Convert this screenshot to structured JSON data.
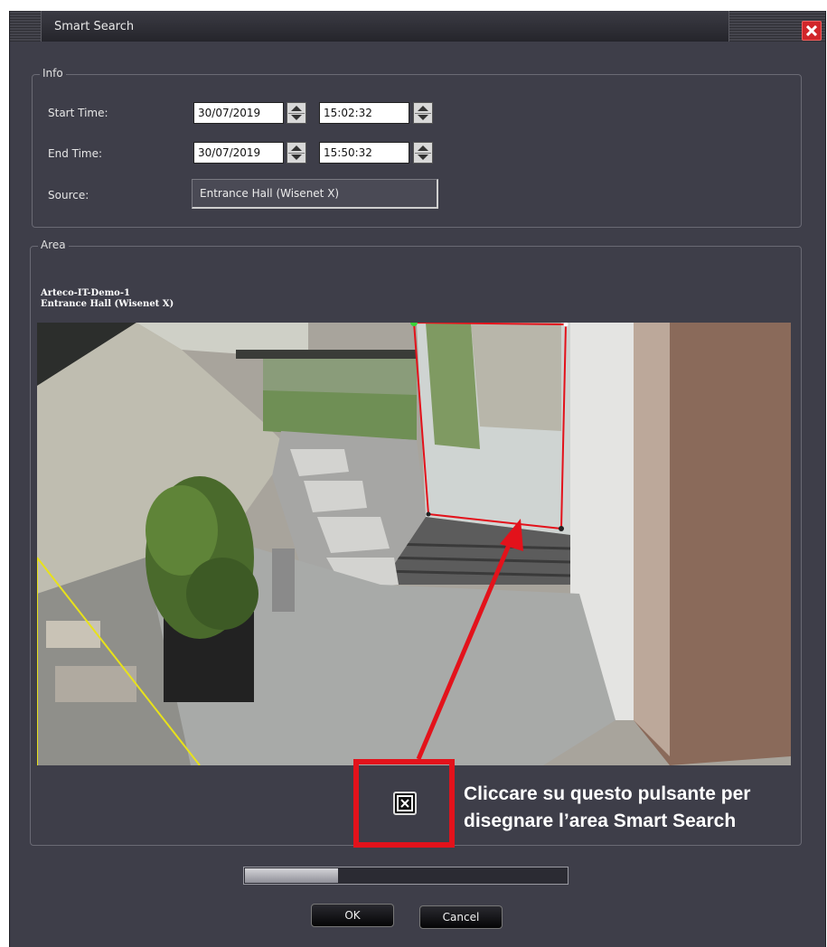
{
  "window": {
    "title": "Smart Search"
  },
  "info": {
    "group_label": "Info",
    "start_time_label": "Start Time:",
    "start_date": "30/07/2019",
    "start_time": "15:02:32",
    "end_time_label": "End Time:",
    "end_date": "30/07/2019",
    "end_time": "15:50:32",
    "source_label": "Source:",
    "source_value": "Entrance Hall  (Wisenet X)"
  },
  "area": {
    "group_label": "Area",
    "camera_line1": "Arteco-IT-Demo-1",
    "camera_line2": "Entrance Hall  (Wisenet X)"
  },
  "annotation": {
    "line1": "Cliccare su questo pulsante per",
    "line2": "disegnare l’area Smart Search",
    "color": "#e3121b"
  },
  "progress": {
    "value": 0.29
  },
  "buttons": {
    "ok": "OK",
    "cancel": "Cancel"
  },
  "icons": {
    "close": "close-icon",
    "draw_area": "draw-area-icon"
  }
}
